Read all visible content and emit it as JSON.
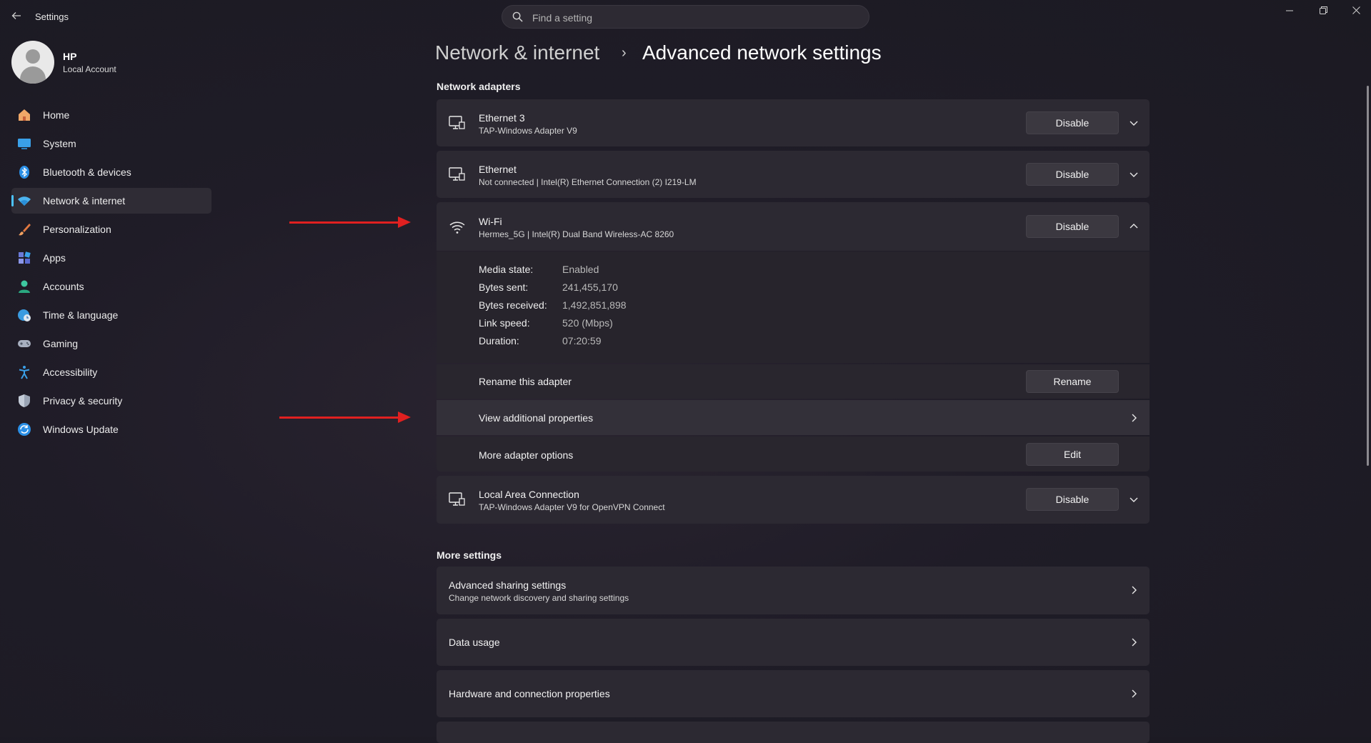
{
  "window": {
    "app_title": "Settings",
    "search_placeholder": "Find a setting"
  },
  "profile": {
    "name": "HP",
    "account_type": "Local Account"
  },
  "nav": [
    {
      "label": "Home",
      "icon": "home-icon"
    },
    {
      "label": "System",
      "icon": "system-icon"
    },
    {
      "label": "Bluetooth & devices",
      "icon": "bluetooth-icon"
    },
    {
      "label": "Network & internet",
      "icon": "wifi-icon",
      "active": true
    },
    {
      "label": "Personalization",
      "icon": "brush-icon"
    },
    {
      "label": "Apps",
      "icon": "apps-icon"
    },
    {
      "label": "Accounts",
      "icon": "accounts-icon"
    },
    {
      "label": "Time & language",
      "icon": "globe-clock-icon"
    },
    {
      "label": "Gaming",
      "icon": "gamepad-icon"
    },
    {
      "label": "Accessibility",
      "icon": "accessibility-icon"
    },
    {
      "label": "Privacy & security",
      "icon": "shield-icon"
    },
    {
      "label": "Windows Update",
      "icon": "update-icon"
    }
  ],
  "breadcrumb": {
    "parent": "Network & internet",
    "separator": "›",
    "current": "Advanced network settings"
  },
  "network_adapters": {
    "title": "Network adapters",
    "adapters": [
      {
        "name": "Ethernet 3",
        "description": "TAP-Windows Adapter V9",
        "button": "Disable",
        "icon": "ethernet-icon"
      },
      {
        "name": "Ethernet",
        "description": "Not connected | Intel(R) Ethernet Connection (2) I219-LM",
        "button": "Disable",
        "icon": "ethernet-icon"
      },
      {
        "name": "Wi-Fi",
        "description": "Hermes_5G | Intel(R) Dual Band Wireless-AC 8260",
        "button": "Disable",
        "icon": "wifi-icon",
        "expanded": true
      },
      {
        "name": "Local Area Connection",
        "description": "TAP-Windows Adapter V9 for OpenVPN Connect",
        "button": "Disable",
        "icon": "ethernet-icon"
      }
    ],
    "wifi_details": [
      {
        "label": "Media state:",
        "value": "Enabled"
      },
      {
        "label": "Bytes sent:",
        "value": "241,455,170"
      },
      {
        "label": "Bytes received:",
        "value": "1,492,851,898"
      },
      {
        "label": "Link speed:",
        "value": "520 (Mbps)"
      },
      {
        "label": "Duration:",
        "value": "07:20:59"
      }
    ],
    "wifi_actions": {
      "rename_label": "Rename this adapter",
      "rename_button": "Rename",
      "view_properties_label": "View additional properties",
      "more_options_label": "More adapter options",
      "edit_button": "Edit"
    }
  },
  "more_settings": {
    "title": "More settings",
    "items": [
      {
        "title": "Advanced sharing settings",
        "subtitle": "Change network discovery and sharing settings"
      },
      {
        "title": "Data usage"
      },
      {
        "title": "Hardware and connection properties"
      }
    ]
  },
  "colors": {
    "accent": "#4cc2ff",
    "annotation_arrow": "#e02020"
  }
}
